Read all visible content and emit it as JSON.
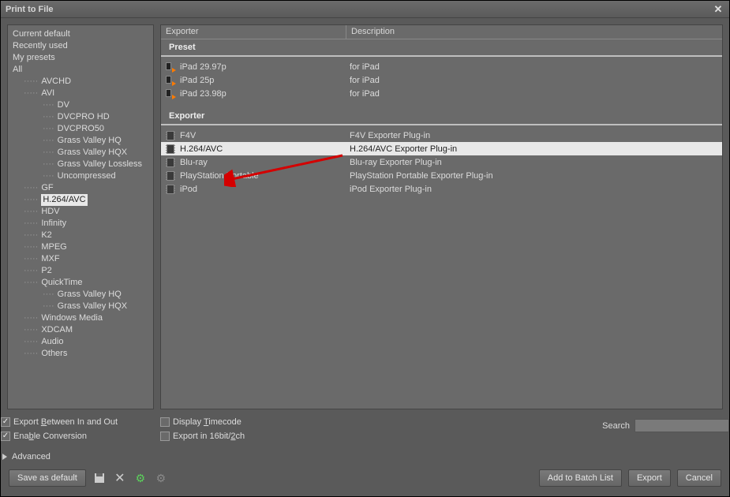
{
  "window": {
    "title": "Print to File"
  },
  "tree": {
    "top": [
      {
        "label": "Current default"
      },
      {
        "label": "Recently used"
      },
      {
        "label": "My presets"
      },
      {
        "label": "All",
        "expanded": true
      }
    ],
    "all": [
      {
        "label": "AVCHD",
        "level": 1
      },
      {
        "label": "AVI",
        "level": 1,
        "children": [
          {
            "label": "DV"
          },
          {
            "label": "DVCPRO HD"
          },
          {
            "label": "DVCPRO50"
          },
          {
            "label": "Grass Valley HQ"
          },
          {
            "label": "Grass Valley HQX"
          },
          {
            "label": "Grass Valley Lossless"
          },
          {
            "label": "Uncompressed"
          }
        ]
      },
      {
        "label": "GF",
        "level": 1
      },
      {
        "label": "H.264/AVC",
        "level": 1,
        "selected": true
      },
      {
        "label": "HDV",
        "level": 1
      },
      {
        "label": "Infinity",
        "level": 1
      },
      {
        "label": "K2",
        "level": 1
      },
      {
        "label": "MPEG",
        "level": 1
      },
      {
        "label": "MXF",
        "level": 1
      },
      {
        "label": "P2",
        "level": 1
      },
      {
        "label": "QuickTime",
        "level": 1,
        "children": [
          {
            "label": "Grass Valley HQ"
          },
          {
            "label": "Grass Valley HQX"
          }
        ]
      },
      {
        "label": "Windows Media",
        "level": 1
      },
      {
        "label": "XDCAM",
        "level": 1
      },
      {
        "label": "Audio",
        "level": 1
      },
      {
        "label": "Others",
        "level": 1
      }
    ]
  },
  "table": {
    "columns": {
      "exporter": "Exporter",
      "description": "Description"
    },
    "groups": [
      {
        "header": "Preset",
        "icon": "preset",
        "rows": [
          {
            "name": "iPad 29.97p",
            "desc": "for iPad"
          },
          {
            "name": "iPad 25p",
            "desc": "for iPad"
          },
          {
            "name": "iPad 23.98p",
            "desc": "for iPad"
          }
        ]
      },
      {
        "header": "Exporter",
        "icon": "film",
        "rows": [
          {
            "name": "F4V",
            "desc": "F4V Exporter Plug-in"
          },
          {
            "name": "H.264/AVC",
            "desc": "H.264/AVC Exporter Plug-in",
            "selected": true
          },
          {
            "name": "Blu-ray",
            "desc": "Blu-ray Exporter Plug-in"
          },
          {
            "name": "PlayStation Portable",
            "desc": "PlayStation Portable Exporter Plug-in"
          },
          {
            "name": "iPod",
            "desc": "iPod Exporter Plug-in"
          }
        ]
      }
    ]
  },
  "options": {
    "export_between": {
      "label_pre": "Export ",
      "label_u": "B",
      "label_post": "etween In and Out",
      "checked": true
    },
    "enable_conversion": {
      "label_pre": "Ena",
      "label_u": "b",
      "label_post": "le Conversion",
      "checked": true
    },
    "display_timecode": {
      "label_pre": "Display ",
      "label_u": "T",
      "label_post": "imecode",
      "checked": false
    },
    "export_16bit": {
      "label_pre": "Export in 16bit/",
      "label_u": "2",
      "label_post": "ch",
      "checked": false
    },
    "advanced": "Advanced",
    "search_label": "Search",
    "search_value": ""
  },
  "footer": {
    "save_default": "Save as default",
    "add_batch": "Add to Batch List",
    "export": "Export",
    "cancel": "Cancel"
  }
}
